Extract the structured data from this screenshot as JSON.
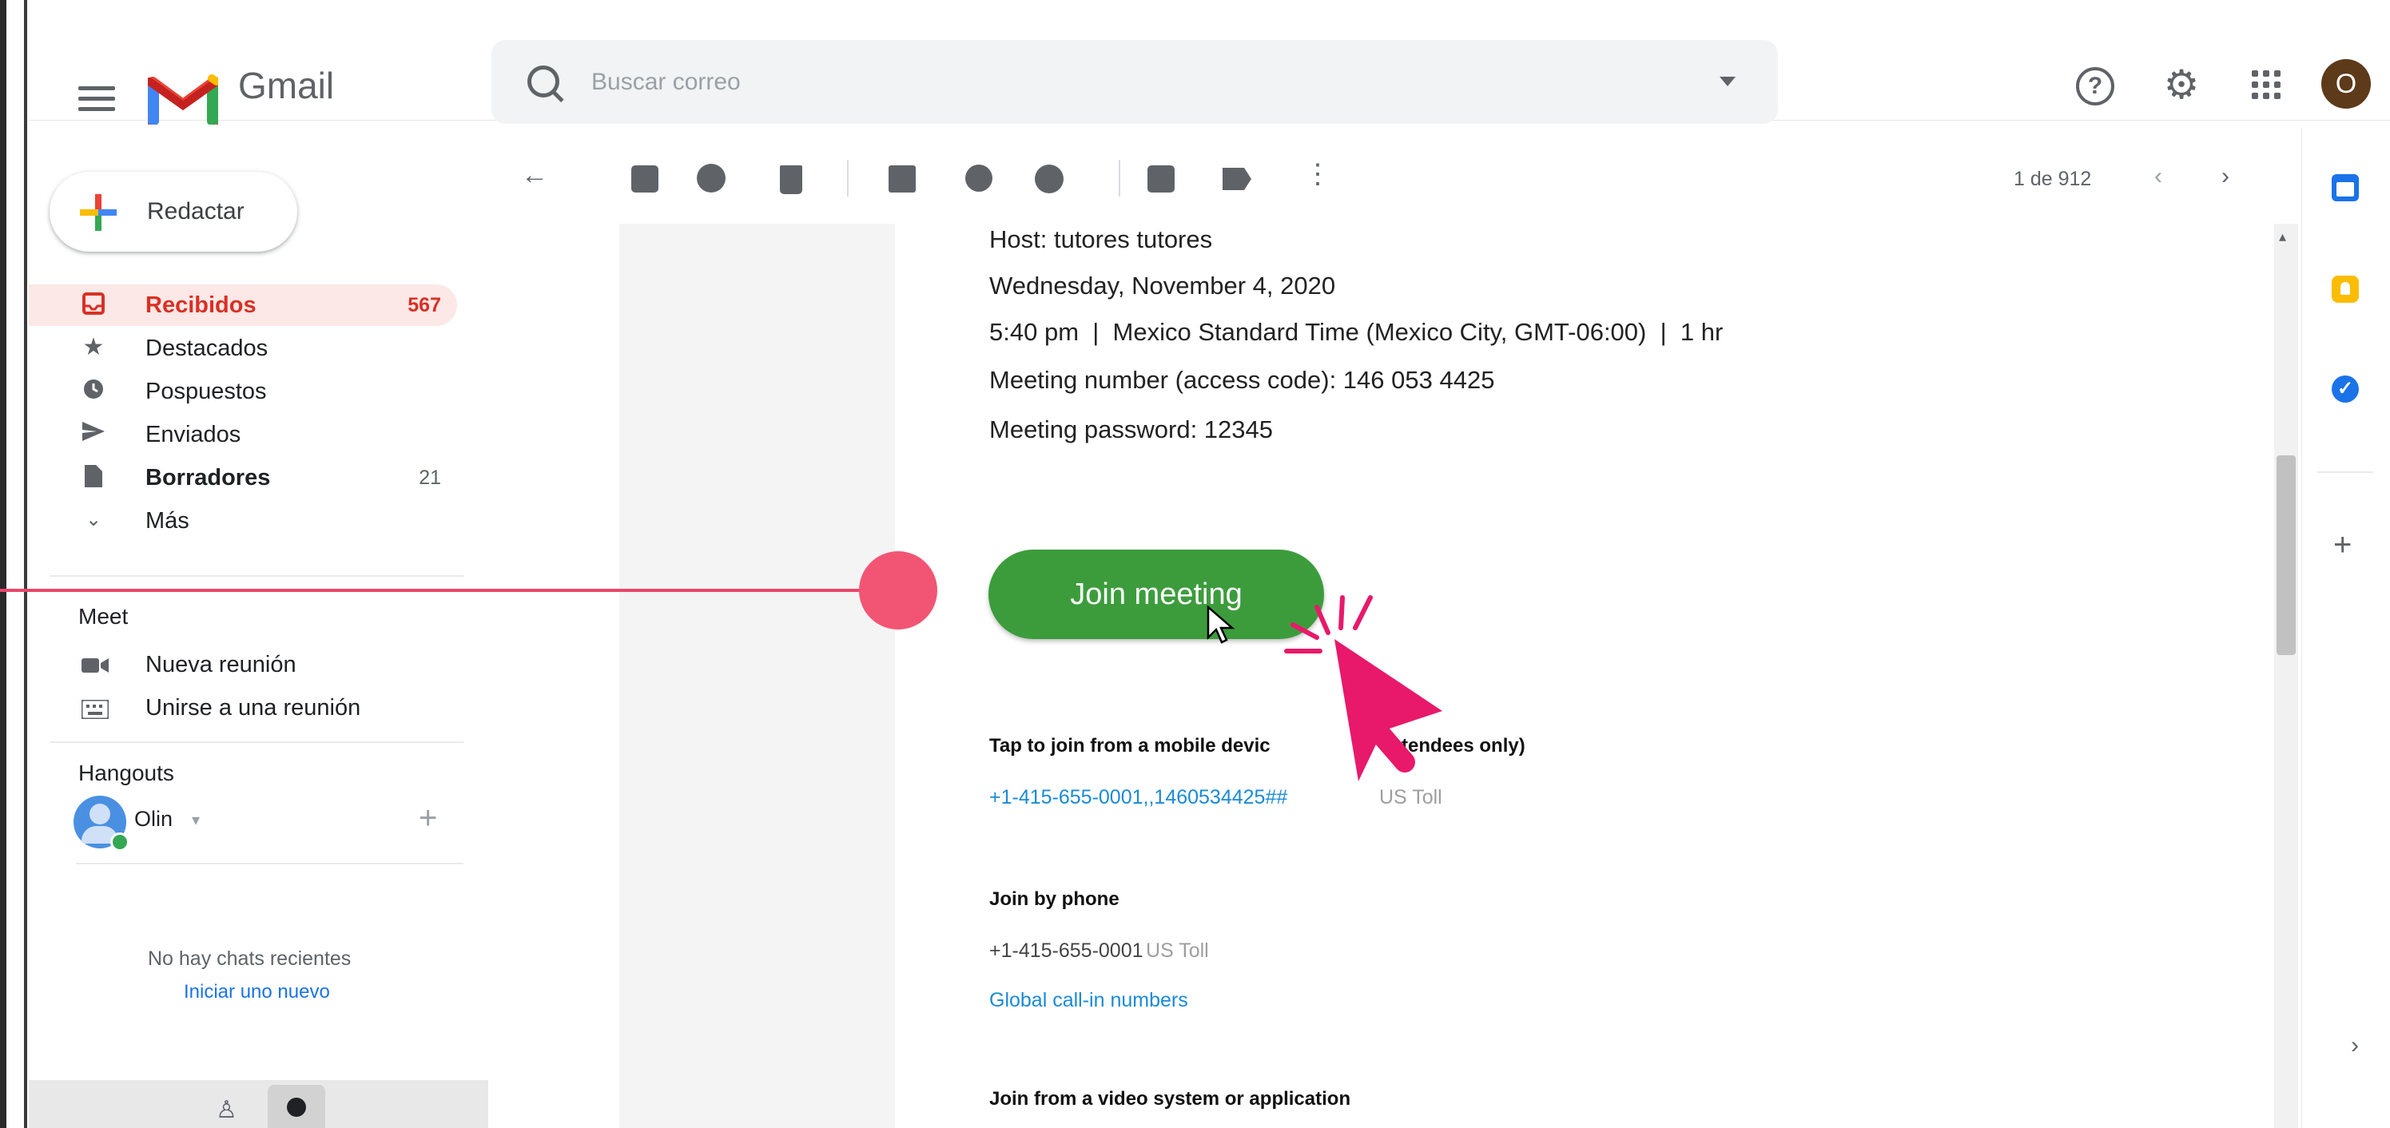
{
  "app": {
    "name": "Gmail",
    "brand_color": "#EA4335"
  },
  "search": {
    "placeholder": "Buscar correo"
  },
  "header": {
    "avatar_initial": "O",
    "help_icon": "help-circle-icon",
    "settings_icon": "gear-icon",
    "apps_icon": "apps-grid-icon"
  },
  "sidebar": {
    "compose_label": "Redactar",
    "items": [
      {
        "label": "Recibidos",
        "count": "567",
        "icon": "inbox-icon",
        "active": true,
        "bold": true
      },
      {
        "label": "Destacados",
        "count": "",
        "icon": "star-icon"
      },
      {
        "label": "Pospuestos",
        "count": "",
        "icon": "clock-icon"
      },
      {
        "label": "Enviados",
        "count": "",
        "icon": "send-icon"
      },
      {
        "label": "Borradores",
        "count": "21",
        "icon": "draft-icon",
        "bold": true
      },
      {
        "label": "Más",
        "count": "",
        "icon": "chevron-down-icon"
      }
    ],
    "meet": {
      "title": "Meet",
      "items": [
        {
          "label": "Nueva reunión",
          "icon": "video-icon"
        },
        {
          "label": "Unirse a una reunión",
          "icon": "keyboard-icon"
        }
      ]
    },
    "hangouts": {
      "title": "Hangouts",
      "user": "Olin",
      "empty_text": "No hay chats recientes",
      "start_link": "Iniciar uno nuevo"
    }
  },
  "toolbar": {
    "pager_text": "1 de 912"
  },
  "email": {
    "host_line": "Host: tutores tutores",
    "date_line": "Wednesday, November 4, 2020",
    "time_line": "5:40 pm  |  Mexico Standard Time (Mexico City, GMT-06:00)  |  1 hr",
    "meeting_number_line": "Meeting number (access code): 146 053 4425",
    "password_line": "Meeting password: 12345",
    "join_button": "Join meeting",
    "mobile_heading": "Tap to join from a mobile devic",
    "mobile_heading_tail": "tendees only)",
    "mobile_link": "+1-415-655-0001,,1460534425##",
    "mobile_toll": "US Toll",
    "phone_heading": "Join by phone",
    "phone_number": "+1-415-655-0001",
    "phone_toll": "US Toll",
    "global_link": "Global call-in numbers",
    "video_heading": "Join from a video system or application"
  },
  "colors": {
    "join_green": "#3c9c3c",
    "annotation_pink": "#e9476a",
    "cursor_pink": "#e8196a",
    "link_blue": "#1a8ad6",
    "active_red": "#d93025"
  }
}
